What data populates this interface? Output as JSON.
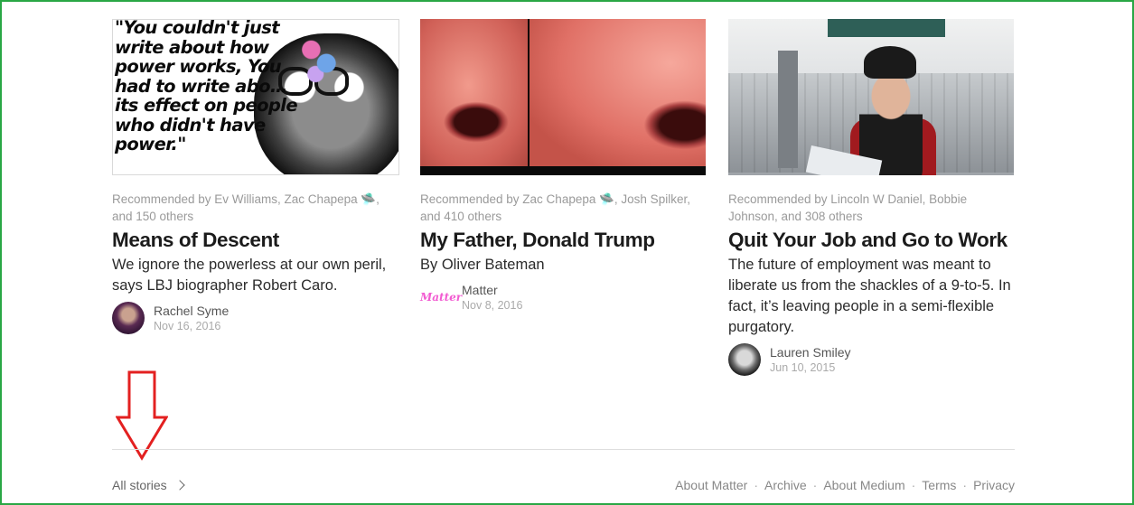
{
  "cards": [
    {
      "recommended": "Recommended by Ev Williams, Zac Chapepa 🛸, and 150 others",
      "title": "Means of Descent",
      "subtitle": "We ignore the powerless at our own peril, says LBJ biographer Robert Caro.",
      "author": "Rachel Syme",
      "date": "Nov 16, 2016",
      "image_quote": "\"You couldn't just write about how power works, You had to write abo… its effect on people who didn't have power.\""
    },
    {
      "recommended": "Recommended by Zac Chapepa 🛸, Josh Spilker, and 410 others",
      "title": "My Father, Donald Trump",
      "subtitle": "By Oliver Bateman",
      "author": "Matter",
      "date": "Nov 8, 2016",
      "avatar_logo_text": "Matter"
    },
    {
      "recommended": "Recommended by Lincoln W Daniel, Bobbie Johnson, and 308 others",
      "title": "Quit Your Job and Go to Work",
      "subtitle": "The future of employment was meant to liberate us from the shackles of a 9-to-5. In fact, it’s leaving people in a semi-flexible purgatory.",
      "author": "Lauren Smiley",
      "date": "Jun 10, 2015"
    }
  ],
  "footer": {
    "all_stories": "All stories",
    "links": [
      "About Matter",
      "Archive",
      "About Medium",
      "Terms",
      "Privacy"
    ],
    "separator": "·"
  },
  "colors": {
    "frame_border": "#29a745",
    "annotation_arrow": "#e32020",
    "matter_pink": "#f25bd1"
  }
}
